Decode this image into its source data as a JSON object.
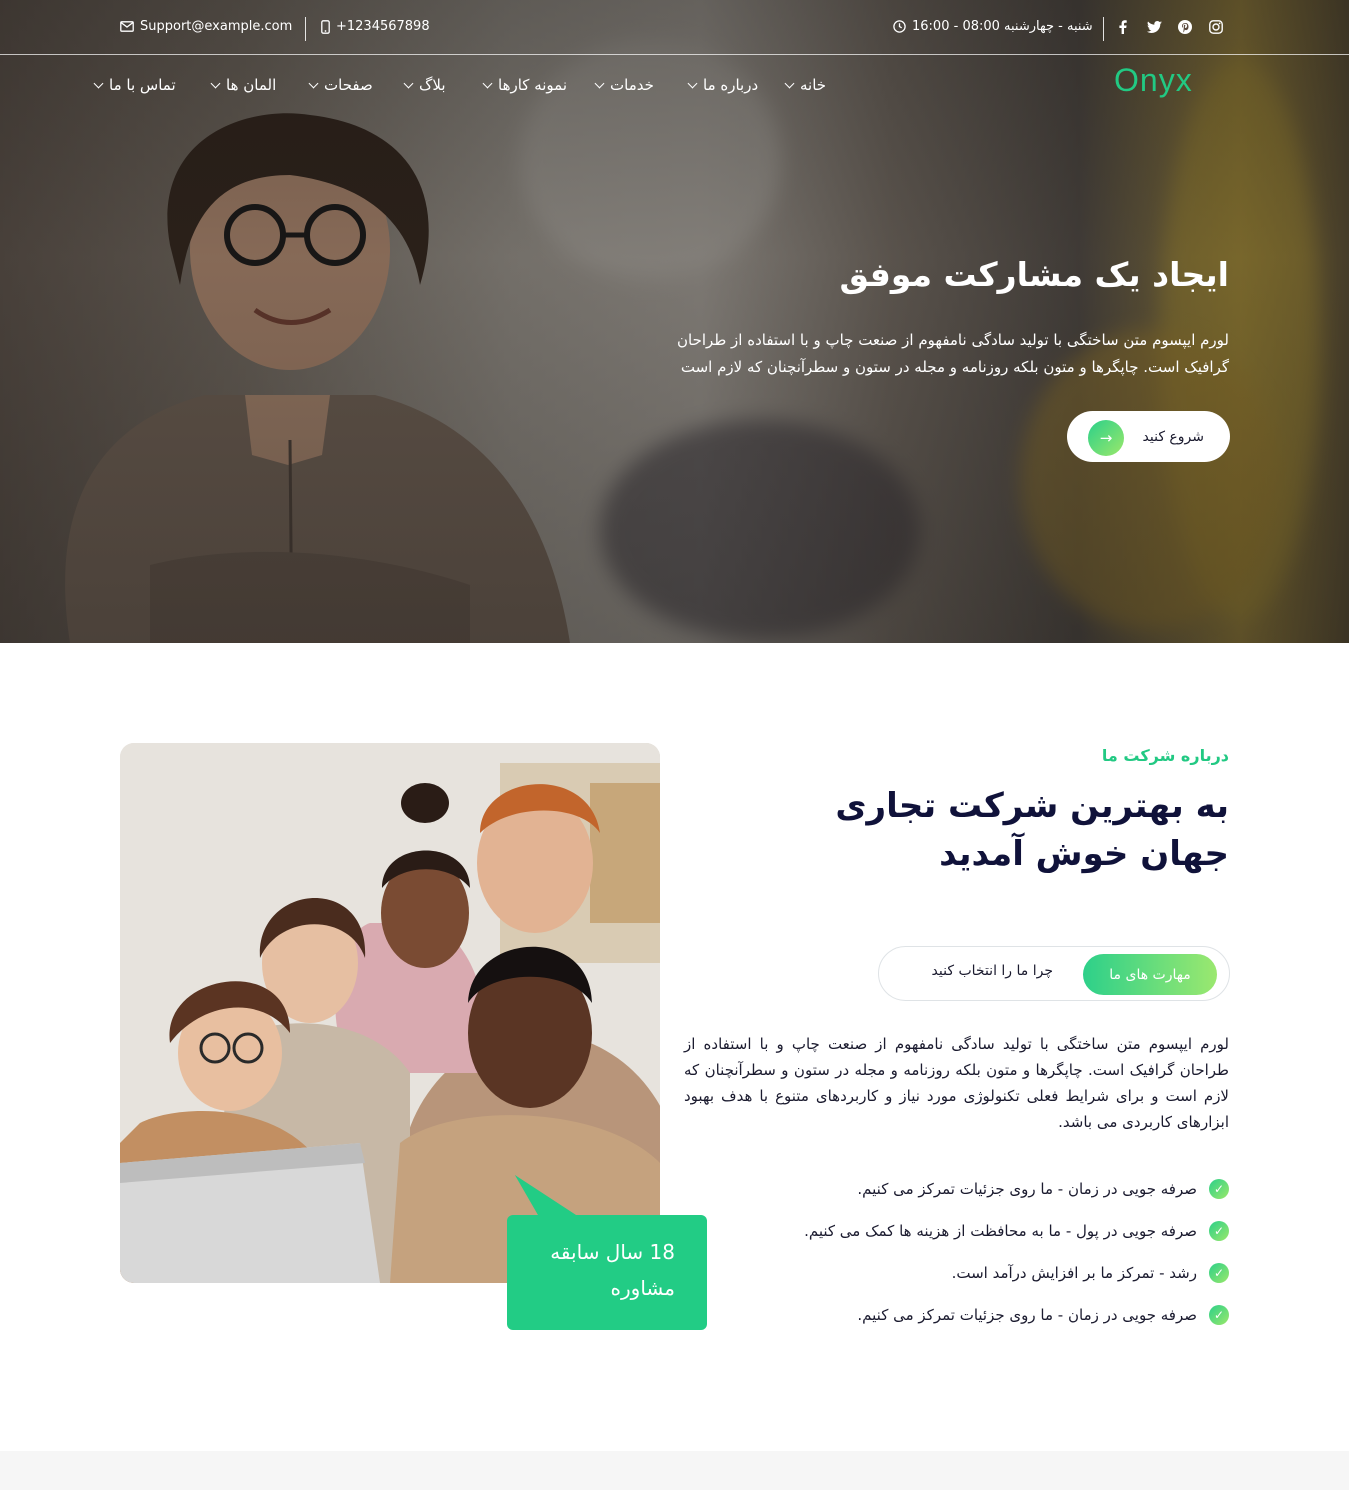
{
  "topbar": {
    "email": "Support@example.com",
    "phone": "+1234567898",
    "hours": "شنبه - چهارشنبه 08:00 - 16:00",
    "social": [
      "facebook-icon",
      "twitter-icon",
      "pinterest-icon",
      "instagram-icon"
    ]
  },
  "nav": {
    "logo": "Onyx",
    "items": [
      {
        "label": "خانه"
      },
      {
        "label": "درباره ما"
      },
      {
        "label": "خدمات"
      },
      {
        "label": "نمونه کارها"
      },
      {
        "label": "بلاگ"
      },
      {
        "label": "صفحات"
      },
      {
        "label": "المان ها"
      },
      {
        "label": "تماس با ما"
      }
    ]
  },
  "hero": {
    "title": "ایجاد یک مشارکت موفق",
    "text": "لورم ایپسوم متن ساختگی با تولید سادگی نامفهوم از صنعت چاپ و با استفاده از طراحان گرافیک است. چاپگرها و متون بلکه روزنامه و مجله در ستون و سطرآنچنان که لازم است",
    "button_label": "شروع کنید",
    "button_arrow": "→"
  },
  "about": {
    "eyebrow": "درباره شرکت ما",
    "title": "به بهترین شرکت تجاری جهان خوش آمدید",
    "tabs": {
      "active": "مهارت های ما",
      "inactive": "چرا ما را انتخاب کنید"
    },
    "text": "لورم ایپسوم متن ساختگی با تولید سادگی نامفهوم از صنعت چاپ و با استفاده از طراحان گرافیک است. چاپگرها و متون بلکه روزنامه و مجله در ستون و سطرآنچنان که لازم است و برای شرایط فعلی تکنولوژی مورد نیاز و کاربردهای متنوع با هدف بهبود ابزارهای کاربردی می باشد.",
    "checklist": [
      "صرفه جویی در زمان - ما روی جزئیات تمرکز می کنیم.",
      "صرفه جویی در پول - ما به محافظت از هزینه ها کمک می کنیم.",
      "رشد - تمرکز ما بر افزایش درآمد است.",
      "صرفه جویی در زمان - ما روی جزئیات تمرکز می کنیم."
    ],
    "badge": "18 سال سابقه مشاوره"
  },
  "colors": {
    "accent": "#22c983",
    "title": "#10123a"
  }
}
